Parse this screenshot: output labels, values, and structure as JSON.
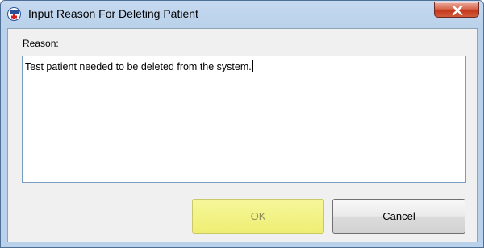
{
  "window": {
    "title": "Input Reason For Deleting Patient",
    "app_icon": "med-app-icon",
    "close_icon": "close-icon"
  },
  "form": {
    "reason_label": "Reason:",
    "reason_value": "Test patient needed to be deleted from the system."
  },
  "buttons": {
    "ok_label": "OK",
    "cancel_label": "Cancel"
  },
  "colors": {
    "ok_button_bg": "#eeee74",
    "close_button_bg": "#c4381c"
  }
}
